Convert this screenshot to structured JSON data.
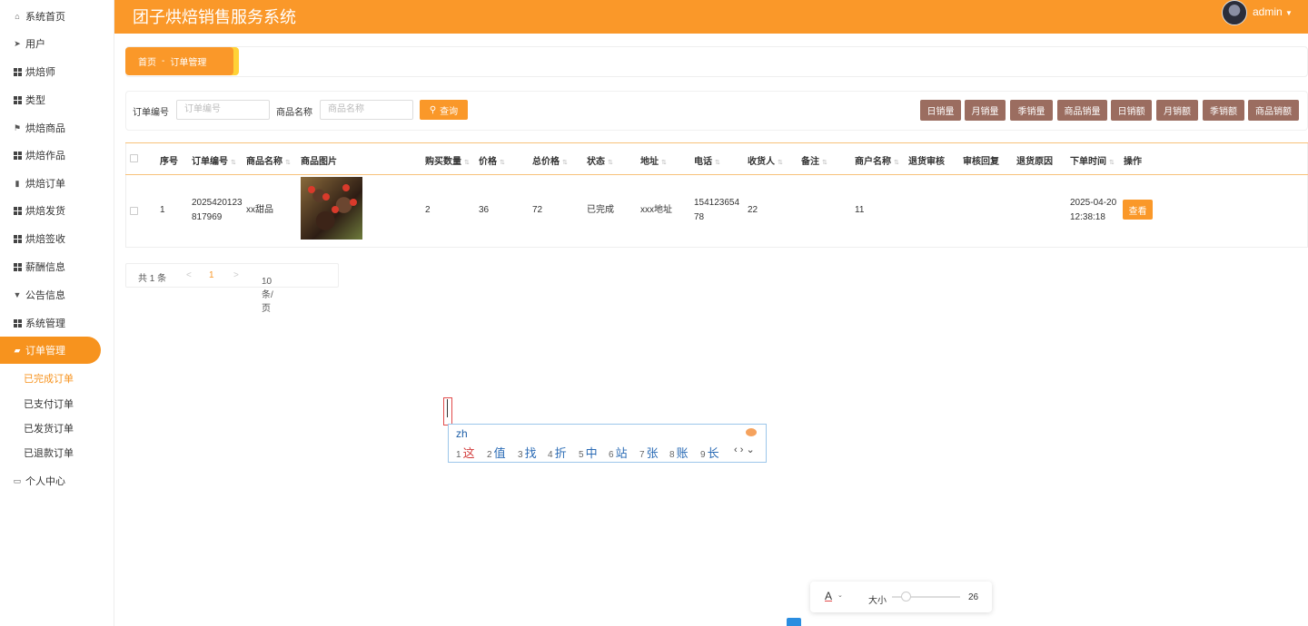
{
  "app": {
    "title": "团子烘焙销售服务系统",
    "user": "admin"
  },
  "sidebar": {
    "items": [
      {
        "label": "系统首页",
        "icon": "home-icon"
      },
      {
        "label": "用户",
        "icon": "send-icon"
      },
      {
        "label": "烘焙师",
        "icon": "grid-icon"
      },
      {
        "label": "类型",
        "icon": "grid-icon"
      },
      {
        "label": "烘焙商品",
        "icon": "flag-icon"
      },
      {
        "label": "烘焙作品",
        "icon": "grid-icon"
      },
      {
        "label": "烘焙订单",
        "icon": "bar-chart-icon"
      },
      {
        "label": "烘焙发货",
        "icon": "grid-icon"
      },
      {
        "label": "烘焙签收",
        "icon": "grid-icon"
      },
      {
        "label": "薪酬信息",
        "icon": "grid-icon"
      },
      {
        "label": "公告信息",
        "icon": "pin-icon"
      },
      {
        "label": "系统管理",
        "icon": "grid-icon"
      },
      {
        "label": "订单管理",
        "icon": "order-icon"
      }
    ],
    "sub_items": [
      "已完成订单",
      "已支付订单",
      "已发货订单",
      "已退款订单"
    ],
    "footer": {
      "label": "个人中心",
      "icon": "card-icon"
    }
  },
  "breadcrumb": {
    "home": "首页",
    "sep": "-",
    "current": "订单管理"
  },
  "search": {
    "order_label": "订单编号",
    "order_placeholder": "订单编号",
    "product_label": "商品名称",
    "product_placeholder": "商品名称",
    "button": "查询"
  },
  "stat_buttons": [
    "日销量",
    "月销量",
    "季销量",
    "商品销量",
    "日销额",
    "月销额",
    "季销额",
    "商品销额"
  ],
  "table": {
    "headers": [
      "序号",
      "订单编号",
      "商品名称",
      "商品图片",
      "购买数量",
      "价格",
      "总价格",
      "状态",
      "地址",
      "电话",
      "收货人",
      "备注",
      "商户名称",
      "退货审核",
      "审核回复",
      "退货原因",
      "下单时间",
      "操作"
    ],
    "row": {
      "index": "1",
      "order_no_1": "2025420123",
      "order_no_2": "817969",
      "product": "xx甜品",
      "qty": "2",
      "price": "36",
      "total": "72",
      "status": "已完成",
      "address": "xxx地址",
      "phone_1": "154123654",
      "phone_2": "78",
      "receiver": "22",
      "merchant": "11",
      "date": "2025-04-20",
      "time": "12:38:18",
      "action": "查看"
    }
  },
  "pager": {
    "total": "共 1 条",
    "prev": "<",
    "page": "1",
    "next": ">",
    "size": "10条/页",
    "size_arrow": "⌄"
  },
  "ime": {
    "pinyin": "zh",
    "candidates": [
      {
        "n": "1",
        "c": "这"
      },
      {
        "n": "2",
        "c": "值"
      },
      {
        "n": "3",
        "c": "找"
      },
      {
        "n": "4",
        "c": "折"
      },
      {
        "n": "5",
        "c": "中"
      },
      {
        "n": "6",
        "c": "站"
      },
      {
        "n": "7",
        "c": "张"
      },
      {
        "n": "8",
        "c": "账"
      },
      {
        "n": "9",
        "c": "长"
      }
    ],
    "nav": "‹ › ⌄"
  },
  "font_tool": {
    "a": "A",
    "arrow": "⌄",
    "size_label": "大小",
    "value": "26"
  },
  "colors": {
    "accent": "#fa9829",
    "stat_button": "#9b6d60",
    "ime_text": "#2a6bb5"
  }
}
